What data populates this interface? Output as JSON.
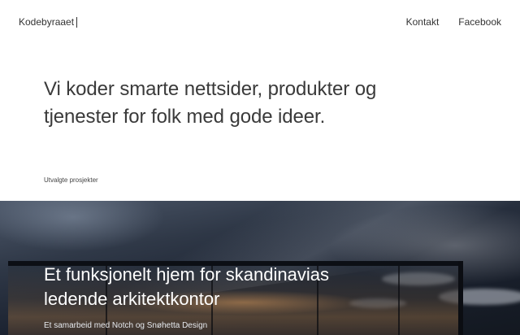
{
  "header": {
    "logo_text": "Kodebyraaet",
    "nav": [
      "Kontakt",
      "Facebook"
    ]
  },
  "hero": {
    "headline": "Vi koder smarte nettsider, produkter og tjenester for folk med gode ideer."
  },
  "projects": {
    "section_label": "Utvalgte prosjekter",
    "featured": {
      "title": "Et funksjonelt hjem for skandinavias ledende arkitektkontor",
      "subtitle": "Et samarbeid med Notch og Snøhetta Design"
    }
  }
}
